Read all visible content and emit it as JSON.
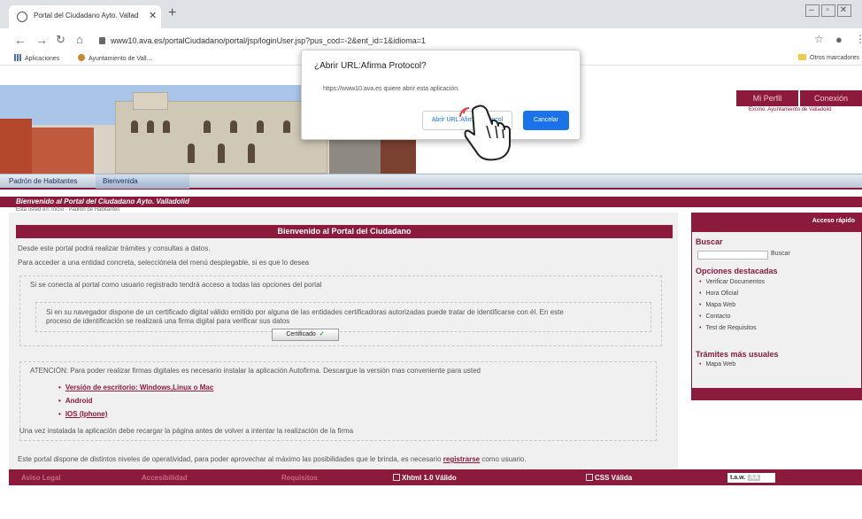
{
  "browser": {
    "tab_title": "Portal del Ciudadano Ayto. Valladoli",
    "tab_close": "✕",
    "new_tab": "+",
    "url": "www10.ava.es/portalCiudadano/portal/jsp/loginUser.jsp?pus_cod=-2&ent_id=1&idioma=1",
    "bookmarks": {
      "apps": "Aplicaciones",
      "ayto": "Ayuntamiento de Vall...",
      "other": "Otros marcadores"
    }
  },
  "dialog": {
    "title": "¿Abrir URL:Afirma Protocol?",
    "message": "https://www10.ava.es quiere abrir esta aplicación.",
    "open_label": "Abrir URL:Afirma Protocol",
    "cancel_label": "Cancelar"
  },
  "header": {
    "mi_perfil": "Mi Perfil",
    "conexion": "Conexión",
    "org": "Excmo. Ayuntamiento de Valladolid"
  },
  "nav": {
    "items": [
      "Padrón de Habitantes",
      "Bienvenida"
    ],
    "welcome": "Bienvenido al Portal del Ciudadano Ayto. Valladolid",
    "breadcrumb": "Esta usted en: Inicio · Padrón de Habitantes"
  },
  "main": {
    "title": "Bienvenido al Portal del Ciudadano",
    "p1": "Desde este portal podrá realizar trámites y consultas a datos.",
    "p2": "Para acceder a una entidad concreta, selecciónela del menú desplegable, si es que lo desea",
    "p3": "Si se conecta al portal como usuario registrado tendrá acceso a todas las opciones del portal",
    "p4a": "Si en su navegador dispone de un certificado digital válido emitido por alguna de las entidades certificadoras autorizadas puede tratar de identificarse con él. En este",
    "p4b": "proceso de identificación se realizará una firma digital para verificar sus datos",
    "cert_button": "Certificado",
    "atencion": "ATENCIÓN: Para poder realizar firmas digitales es necesario instalar la aplicación Autofirma. Descargue la versión mas conveniente para usted",
    "downloads": [
      "Versión de escritorio: Windows,Linux o Mac",
      "Android",
      "IOS (Iphone)"
    ],
    "reload_note": "Una vez instalada la aplicación debe recargar la página antes de volver a intentar la realización de la firma",
    "bottom_pre": "Este portal dispone de distintos niveles de operatividad, para poder aprovechar al máximo las posibilidades que le brinda, es necesario",
    "bottom_link": "registrarse",
    "bottom_post": "como usuario."
  },
  "sidebar": {
    "header": "Acceso rápido",
    "buscar_title": "Buscar",
    "buscar_button": "Buscar",
    "opciones_title": "Opciones destacadas",
    "opciones": [
      "Verificar Documentos",
      "Hora Oficial",
      "Mapa Web",
      "Contacto",
      "Test de Requisitos"
    ],
    "tramites_title": "Trámites más usuales",
    "tramites": [
      "Mapa Web"
    ]
  },
  "footer": {
    "aviso": "Aviso Legal",
    "accesibilidad": "Accesibilidad",
    "requisitos": "Requisitos",
    "xhtml": "Xhtml 1.0 Válido",
    "css": "CSS Válida",
    "taw": "t.a.w.",
    "taw_badge": "AA"
  }
}
